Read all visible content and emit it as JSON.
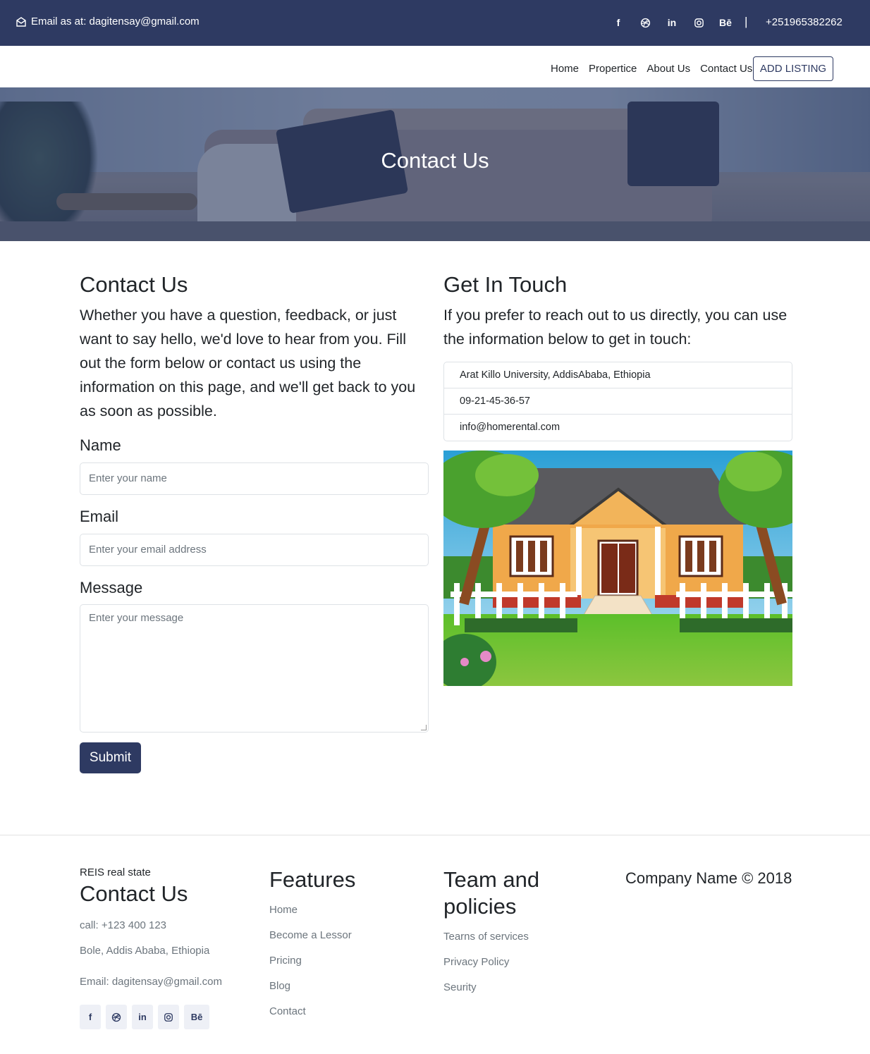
{
  "topbar": {
    "email_text": "Email as at: dagitensay@gmail.com",
    "socials": [
      "facebook-icon",
      "dribbble-icon",
      "linkedin-icon",
      "instagram-icon",
      "behance-icon"
    ],
    "separator": "|",
    "phone": "+251965382262"
  },
  "nav": {
    "links": [
      "Home",
      "Propertice",
      "About Us",
      "Contact Us"
    ],
    "cta": "ADD LISTING"
  },
  "hero": {
    "title": "Contact Us"
  },
  "contact": {
    "heading": "Contact Us",
    "intro": "Whether you have a question, feedback, or just want to say hello, we'd love to hear from you. Fill out the form below or contact us using the information on this page, and we'll get back to you as soon as possible.",
    "form": {
      "name_label": "Name",
      "name_placeholder": "Enter your name",
      "email_label": "Email",
      "email_placeholder": "Enter your email address",
      "message_label": "Message",
      "message_placeholder": "Enter your message",
      "submit_label": "Submit"
    }
  },
  "touch": {
    "heading": "Get In Touch",
    "intro": "If you prefer to reach out to us directly, you can use the information below to get in touch:",
    "items": [
      "Arat Killo University, AddisAbaba, Ethiopia",
      "09-21-45-36-57",
      "info@homerental.com"
    ]
  },
  "footer": {
    "brand": "REIS real state",
    "contact_heading": "Contact Us",
    "call": "call: +123 400 123",
    "address": "Bole, Addis Ababa, Ethiopia",
    "email": "Email: dagitensay@gmail.com",
    "features_heading": "Features",
    "features": [
      "Home",
      "Become a Lessor",
      "Pricing",
      "Blog",
      "Contact"
    ],
    "team_heading": "Team and policies",
    "team": [
      "Tearns of services",
      "Privacy Policy",
      "Seurity"
    ],
    "copyright": "Company Name © 2018"
  },
  "colors": {
    "primary": "#2e3a62",
    "muted": "#6c757d",
    "border": "#dee2e6"
  }
}
